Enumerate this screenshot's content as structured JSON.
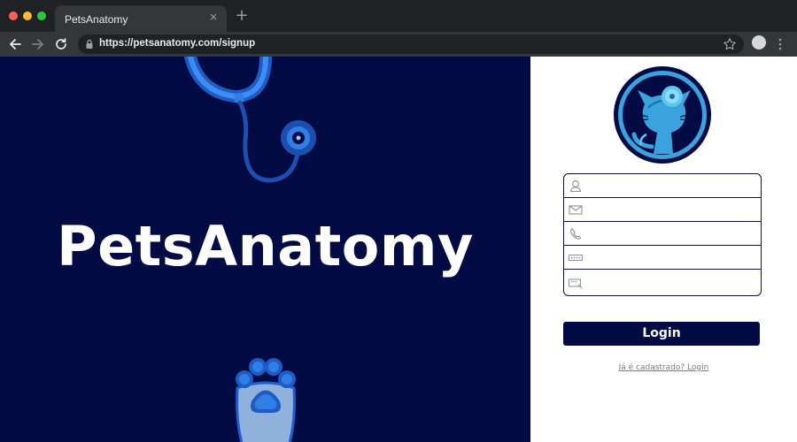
{
  "browser": {
    "tab_title": "PetsAnatomy",
    "tab_close": "×",
    "new_tab": "+",
    "url": "https://petsanatomy.com/signup"
  },
  "hero": {
    "brand": "PetsAnatomy",
    "background_color": "#020b44"
  },
  "form": {
    "fields": [
      {
        "name": "name",
        "icon": "user-icon",
        "placeholder": ""
      },
      {
        "name": "email",
        "icon": "envelope-icon",
        "placeholder": ""
      },
      {
        "name": "phone",
        "icon": "phone-icon",
        "placeholder": ""
      },
      {
        "name": "password",
        "icon": "password-icon",
        "placeholder": ""
      },
      {
        "name": "password-confirm",
        "icon": "key-card-icon",
        "placeholder": ""
      }
    ],
    "login_label": "Login",
    "already_registered": "Já é cadastrado? Login"
  },
  "colors": {
    "navy": "#020b44",
    "accent_blue": "#2f7fe6",
    "logo_ring": "#3aa3dd"
  }
}
